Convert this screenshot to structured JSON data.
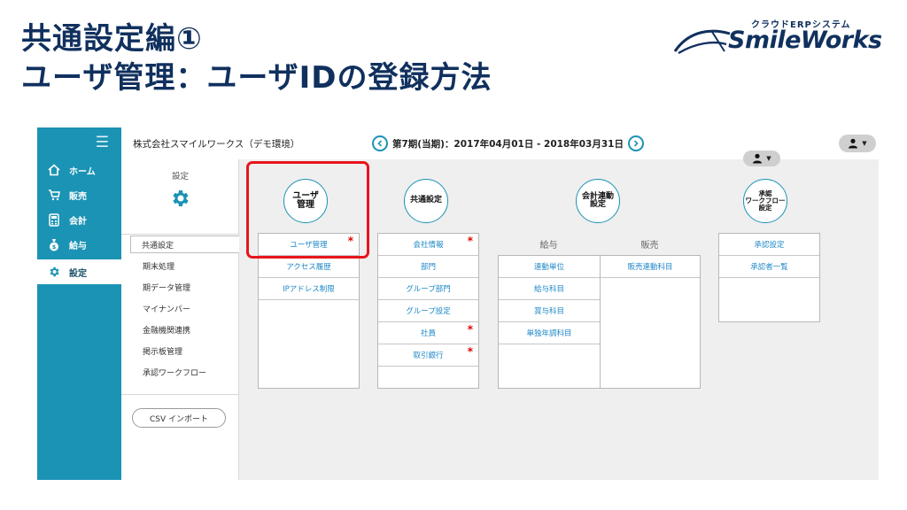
{
  "slide": {
    "title_line1": "共通設定編①",
    "title_line2": "ユーザ管理：ユーザIDの登録方法"
  },
  "logo": {
    "subtitle": "クラウドERPシステム",
    "name": "SmileWorks",
    "color": "#10305e"
  },
  "sidebar": {
    "menu_icon": "hamburger-icon",
    "items": [
      {
        "label": "ホーム",
        "icon": "home-icon"
      },
      {
        "label": "販売",
        "icon": "cart-icon"
      },
      {
        "label": "会計",
        "icon": "calculator-icon"
      },
      {
        "label": "給与",
        "icon": "money-bag-icon"
      },
      {
        "label": "設定",
        "icon": "gear-icon",
        "active": true
      }
    ]
  },
  "topbar": {
    "company": "株式会社スマイルワークス（デモ環境）",
    "period": "第7期(当期)：2017年04月01日 - 2018年03月31日"
  },
  "left_panel": {
    "title": "設定",
    "items": [
      "共通設定",
      "期末処理",
      "期データ管理",
      "マイナンバー",
      "金融機関連携",
      "掲示板管理",
      "承認ワークフロー"
    ],
    "active_index": 0,
    "csv_button": "CSV インポート"
  },
  "modules": {
    "user": {
      "title": "ユーザ\n管理",
      "items": [
        {
          "label": "ユーザ管理",
          "required": true
        },
        {
          "label": "アクセス履歴",
          "required": false
        },
        {
          "label": "IPアドレス制限",
          "required": false
        }
      ]
    },
    "common": {
      "title": "共通設定",
      "items": [
        {
          "label": "会社情報",
          "required": true
        },
        {
          "label": "部門",
          "required": false
        },
        {
          "label": "グループ部門",
          "required": false
        },
        {
          "label": "グループ設定",
          "required": false
        },
        {
          "label": "社員",
          "required": true
        },
        {
          "label": "取引銀行",
          "required": true
        }
      ]
    },
    "accounting": {
      "title": "会計連動\n設定",
      "salary": {
        "header": "給与",
        "items": [
          "連動単位",
          "給与科目",
          "賞与科目",
          "単独年調科目"
        ]
      },
      "sales": {
        "header": "販売",
        "items": [
          "販売連動科目"
        ]
      }
    },
    "workflow": {
      "title": "承認\nワークフロー\n設定",
      "items": [
        "承認設定",
        "承認者一覧"
      ]
    }
  },
  "required_mark": "*",
  "colors": {
    "sidebar": "#1b93b4",
    "accent": "#1b93b4",
    "link": "#1e88c7",
    "required": "#e00000",
    "highlight": "#e8151b"
  }
}
